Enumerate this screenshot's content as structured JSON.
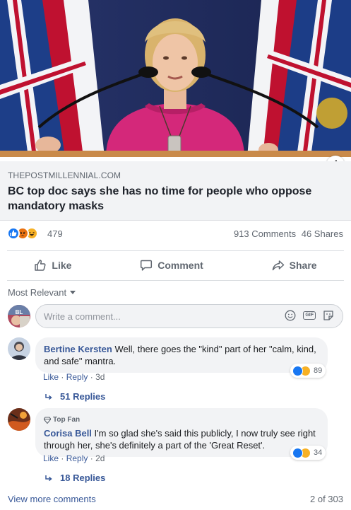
{
  "post": {
    "link_domain": "THEPOSTMILLENNIAL.COM",
    "link_headline": "BC top doc says she has no time for people who oppose mandatory masks",
    "info_icon": "info-icon",
    "image_subject": "photo-press-conference"
  },
  "engagement": {
    "reactions": [
      "like",
      "angry",
      "haha"
    ],
    "reaction_count": "479",
    "comments_count": "913 Comments",
    "shares_count": "46 Shares"
  },
  "actions": {
    "like": "Like",
    "comment": "Comment",
    "share": "Share"
  },
  "comments_section": {
    "sort_label": "Most Relevant",
    "composer_placeholder": "Write a comment...",
    "composer_gif": "GIF",
    "items": [
      {
        "author": "Bertine Kersten",
        "text": "Well, there goes the \"kind\" part of her \"calm, kind, and safe\" mantra.",
        "like": "Like",
        "reply": "Reply",
        "time": "3d",
        "reaction_count": "89",
        "replies": "51 Replies"
      },
      {
        "badge": "Top Fan",
        "author": "Corisa Bell",
        "text": "I'm so glad she's said this publicly, I now truly see right through her, she's definitely a part of the 'Great Reset'.",
        "like": "Like",
        "reply": "Reply",
        "time": "2d",
        "reaction_count": "34",
        "replies": "18 Replies"
      }
    ],
    "view_more": "View more comments",
    "pagination": "2 of 303"
  },
  "colors": {
    "link_blue": "#385898",
    "like_blue": "#1877f2",
    "meta_gray": "#606770",
    "bubble_bg": "#f2f3f5"
  }
}
